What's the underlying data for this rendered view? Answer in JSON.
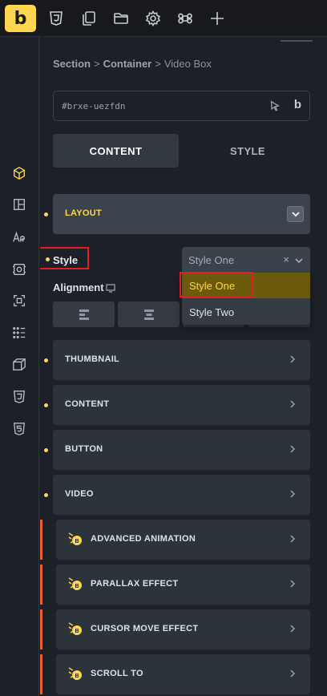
{
  "toolbar": {
    "logo": "b",
    "icons": [
      "css3-icon",
      "pages-icon",
      "folder-icon",
      "gear-icon",
      "command-icon",
      "plus-icon"
    ]
  },
  "rail": {
    "icons": [
      "cube-icon",
      "layout-icon",
      "typography-icon",
      "image-icon",
      "frame-icon",
      "grid-dots-icon",
      "box-3d-icon",
      "css3-icon",
      "html5-icon"
    ]
  },
  "breadcrumb": {
    "part1": "Section",
    "sep1": ">",
    "part2": "Container",
    "sep2": ">",
    "part3": "Video Box"
  },
  "element_id": "#brxe-uezfdn",
  "id_box_logo": "b",
  "tabs": {
    "content": "CONTENT",
    "style": "STYLE"
  },
  "layout": {
    "title": "LAYOUT",
    "style_label": "Style",
    "style_select": {
      "value": "Style One",
      "clear": "×",
      "options": [
        "Style One",
        "Style Two"
      ]
    },
    "alignment_label": "Alignment"
  },
  "sections": [
    {
      "title": "THUMBNAIL"
    },
    {
      "title": "CONTENT"
    },
    {
      "title": "BUTTON"
    },
    {
      "title": "VIDEO"
    }
  ],
  "plugin_sections": [
    {
      "title": "ADVANCED ANIMATION"
    },
    {
      "title": "PARALLAX EFFECT"
    },
    {
      "title": "CURSOR MOVE EFFECT"
    },
    {
      "title": "SCROLL TO"
    }
  ],
  "colors": {
    "accent": "#ffd64f",
    "highlight_red": "#e01e24",
    "plugin_bar": "#e8602c"
  }
}
